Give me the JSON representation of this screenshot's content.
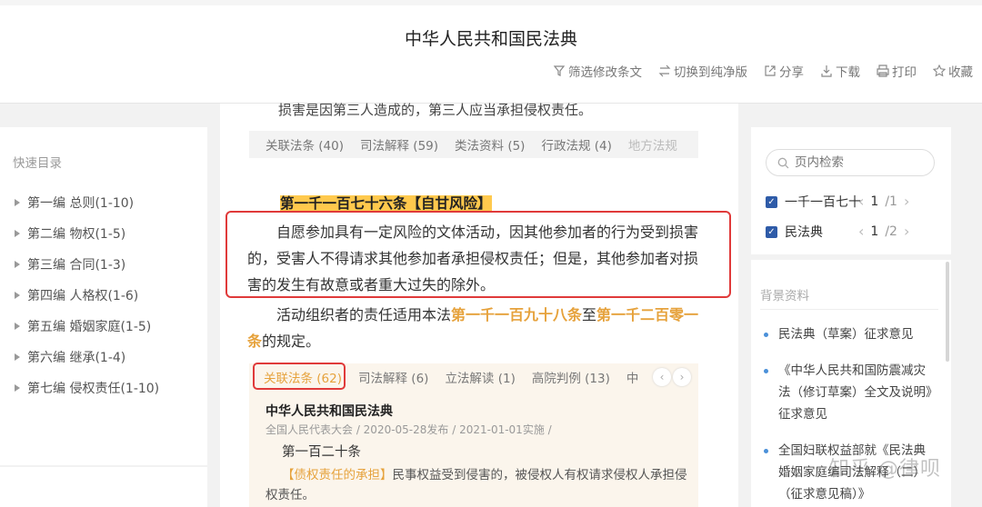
{
  "header": {
    "title": "中华人民共和国民法典",
    "tools": [
      {
        "label": "筛选修改条文",
        "icon": "filter-icon"
      },
      {
        "label": "切换到纯净版",
        "icon": "switch-icon"
      },
      {
        "label": "分享",
        "icon": "share-icon"
      },
      {
        "label": "下载",
        "icon": "download-icon"
      },
      {
        "label": "打印",
        "icon": "print-icon"
      },
      {
        "label": "收藏",
        "icon": "star-icon"
      }
    ]
  },
  "sidebar": {
    "quick_label": "快速目录",
    "items": [
      "第一编 总则(1-10)",
      "第二编 物权(1-5)",
      "第三编 合同(1-3)",
      "第四编 人格权(1-6)",
      "第五编 婚姻家庭(1-5)",
      "第六编 继承(1-4)",
      "第七编 侵权责任(1-10)"
    ]
  },
  "main": {
    "cut_text": "损害是因第三人造成的，第三人应当承担侵权责任。",
    "tabs1": [
      "关联法条 (40)",
      "司法解释 (59)",
      "类法资料 (5)",
      "行政法规 (4)",
      "地方法规"
    ],
    "article": {
      "number": "第一千一百七十六条",
      "title": "【自甘风险】",
      "para1": "自愿参加具有一定风险的文体活动，因其他参加者的行为受到损害的，受害人不得请求其他参加者承担侵权责任；但是，其他参加者对损害的发生有故意或者重大过失的除外。",
      "para2_pre": "活动组织者的责任适用本法",
      "para2_link1": "第一千一百九十八条",
      "para2_mid": "至",
      "para2_link2": "第一千二百零一条",
      "para2_post": "的规定。"
    },
    "sub": {
      "tabs": [
        "关联法条 (62)",
        "司法解释 (6)",
        "立法解读 (1)",
        "高院判例 (13)",
        "中"
      ],
      "law_name": "中华人民共和国民法典",
      "meta": "全国人民代表大会 / 2020-05-28发布 / 2021-01-01实施 /",
      "article_no": "第一百二十条",
      "tag": "【债权责任的承担】",
      "body": "民事权益受到侵害的，被侵权人有权请求侵权人承担侵权责任。"
    }
  },
  "right": {
    "search_placeholder": "页内检索",
    "filters": [
      {
        "label": "一千一百七十",
        "current": "1",
        "total": "/1"
      },
      {
        "label": "民法典",
        "current": "1",
        "total": "/2"
      }
    ],
    "background_title": "背景资料",
    "background_items": [
      "民法典（草案）征求意见",
      "《中华人民共和国防震减灾法（修订草案）全文及说明》征求意见",
      "全国妇联权益部就《民法典婚姻家庭编司法解释（二）（征求意见稿）》"
    ]
  },
  "watermark": "知乎 @律呗",
  "colors": {
    "accent": "#e6a23c",
    "highlight": "#ffc94d",
    "redbox": "#e03a3a",
    "checkbox": "#2e5ba8",
    "bullet": "#4a90d9"
  }
}
